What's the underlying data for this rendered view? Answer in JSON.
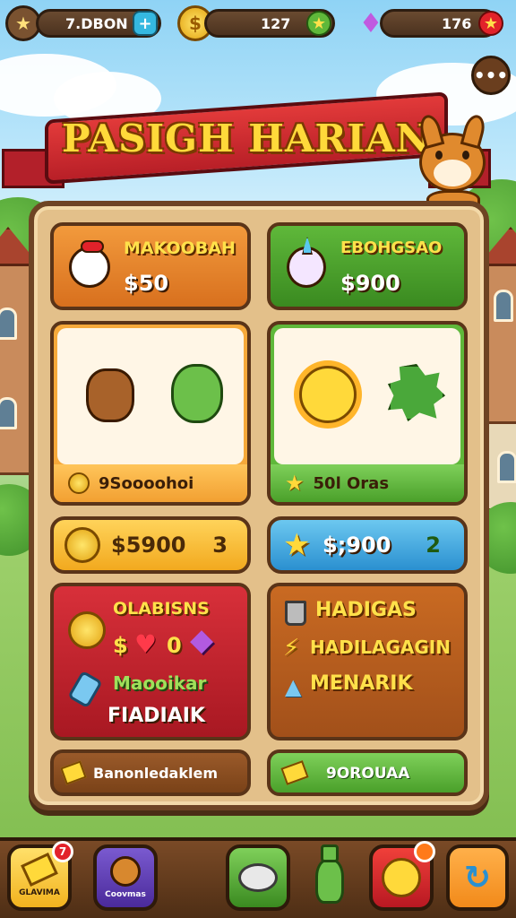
{
  "topbar": {
    "currency1": "7.DBON",
    "currency2": "127",
    "currency3": "176"
  },
  "banner": {
    "title": "PASIGH HARIAN"
  },
  "cards": {
    "orange": {
      "title": "MAKOOBAH",
      "value": "$50"
    },
    "green": {
      "title": "EBOHGSAO",
      "value": "$900"
    },
    "pets_left_label": "9Soooohoi",
    "pets_right_label": "50l Oras",
    "coin_bar": {
      "value": "$5900",
      "count": "3"
    },
    "blue_bar": {
      "value": "$;900",
      "count": "2"
    },
    "red_panel": {
      "line1": "OLABISNS",
      "line2": "$",
      "line3": "0",
      "line4": "Maooikar",
      "line5": "FIADIAIK"
    },
    "brown_panel": {
      "line1": "HADIGAS",
      "line2": "HADILAGAGIN",
      "line3": "MENARIK"
    },
    "bottom_left": "Banonledaklem",
    "bottom_right": "9OROUAA"
  },
  "nav": {
    "btn1_label": "GLAVIMA",
    "btn1_badge": "7",
    "btn2_label": "Coovmas"
  },
  "colors": {
    "accent": "#e23a3a",
    "gold": "#ffd93a",
    "wood": "#6e4424"
  }
}
